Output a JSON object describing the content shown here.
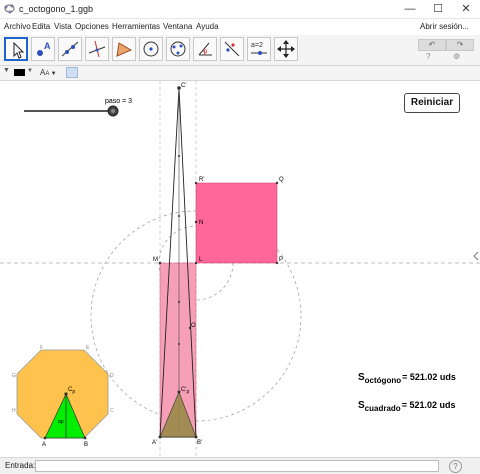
{
  "window": {
    "title": "c_octogono_1.ggb",
    "minimize": "—",
    "maximize": "☐",
    "close": "✕"
  },
  "menu": {
    "items": [
      "Archivo",
      "Edita",
      "Vista",
      "Opciones",
      "Herramientas",
      "Ventana",
      "Ayuda"
    ],
    "signin": "Abrir sesión..."
  },
  "toolbar": {
    "tools": [
      "move-tool-icon",
      "point-tool-icon",
      "line-tool-icon",
      "perpendicular-tool-icon",
      "polygon-tool-icon",
      "circle-tool-icon",
      "conic-tool-icon",
      "angle-tool-icon",
      "reflect-tool-icon",
      "slider-tool-icon",
      "move-view-tool-icon"
    ],
    "slider_tool_label": "a=2"
  },
  "stylebar": {
    "text_size": "A"
  },
  "graphics": {
    "slider_label": "paso = 3",
    "reset_button": "Reiniciar",
    "area_octagon_prefix": "S",
    "area_octagon_sub": "octógono",
    "area_octagon_value": "= 521.02 uds",
    "area_square_prefix": "S",
    "area_square_sub": "cuadrado",
    "area_square_value": "= 521.02 uds",
    "point_labels": {
      "C1": "C'",
      "R1": "R'",
      "Q": "Q",
      "N": "N",
      "M": "M",
      "L": "L",
      "P": "P",
      "O": "O",
      "Cp1": "C'",
      "Cp1_sub": "p",
      "A1": "A'",
      "B1": "B'",
      "A": "A",
      "B": "B",
      "Cp": "C",
      "Cp_sub": "p",
      "ap": "ap",
      "F": "F",
      "E": "E",
      "G": "G",
      "D": "D",
      "H": "H",
      "C": "C"
    },
    "colors": {
      "square_fill": "#ff6699",
      "rectangle_fill": "#f590ac",
      "octagon_fill": "#ffc34d",
      "triangle_fill": "#00ee00",
      "small_triangle_fill": "#9a8a4a"
    }
  },
  "input_bar": {
    "label": "Entrada:",
    "value": "",
    "help": "?"
  }
}
